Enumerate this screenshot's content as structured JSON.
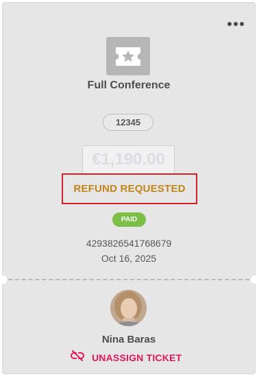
{
  "ticket": {
    "name": "Full Conference",
    "code": "12345",
    "price": "€1,190.00",
    "status": "REFUND REQUESTED",
    "payment_badge": "PAID",
    "order_number": "4293826541768679",
    "date": "Oct 16, 2025"
  },
  "assignee": {
    "name": "Nina Baras",
    "action_label": "UNASSIGN TICKET"
  },
  "icons": {
    "menu": "more-horizontal-icon",
    "ticket": "ticket-star-icon",
    "unassign": "unlink-icon"
  },
  "colors": {
    "card_background": "#e6e6e6",
    "status_text": "#c08418",
    "highlight_border": "#d0212a",
    "paid_badge": "#7bbf47",
    "unassign_action": "#e0185a"
  }
}
